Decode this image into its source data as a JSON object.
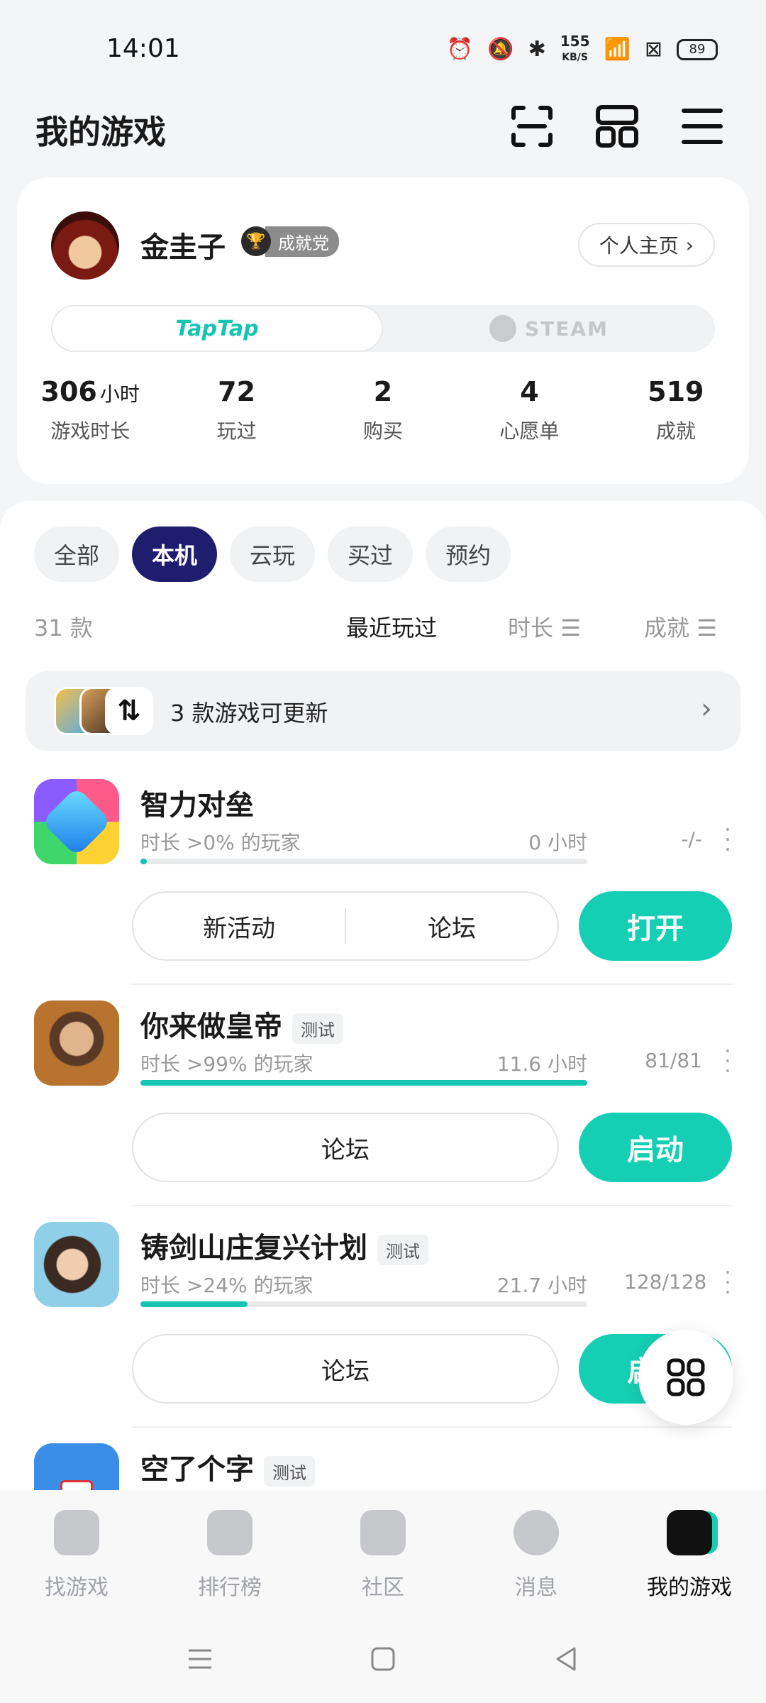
{
  "status_bar": {
    "time": "14:01",
    "net_speed": "155",
    "net_unit": "KB/S",
    "battery": "89"
  },
  "header": {
    "title": "我的游戏"
  },
  "profile": {
    "username": "金圭子",
    "badge": "成就党",
    "home_button": "个人主页",
    "platform_tabs": [
      "TapTap",
      "STEAM"
    ],
    "stats": [
      {
        "value": "306",
        "unit": "小时",
        "label": "游戏时长"
      },
      {
        "value": "72",
        "unit": "",
        "label": "玩过"
      },
      {
        "value": "2",
        "unit": "",
        "label": "购买"
      },
      {
        "value": "4",
        "unit": "",
        "label": "心愿单"
      },
      {
        "value": "519",
        "unit": "",
        "label": "成就"
      }
    ]
  },
  "filters": {
    "chips": [
      "全部",
      "本机",
      "云玩",
      "买过",
      "预约"
    ],
    "active": "本机"
  },
  "sort": {
    "count": "31 款",
    "recent": "最近玩过",
    "time": "时长",
    "achievements": "成就"
  },
  "update_banner": {
    "text": "3 款游戏可更新"
  },
  "games": [
    {
      "name": "智力对垒",
      "tag": "",
      "playtime_label": "时长 >0% 的玩家",
      "hours": "0 小时",
      "achievements": "-/-",
      "progress": 0.01,
      "actions": [
        "新活动",
        "论坛"
      ],
      "primary": "打开"
    },
    {
      "name": "你来做皇帝",
      "tag": "测试",
      "playtime_label": "时长 >99% 的玩家",
      "hours": "11.6 小时",
      "achievements": "81/81",
      "progress": 1.0,
      "actions": [
        "论坛"
      ],
      "primary": "启动"
    },
    {
      "name": "铸剑山庄复兴计划",
      "tag": "测试",
      "playtime_label": "时长 >24% 的玩家",
      "hours": "21.7 小时",
      "achievements": "128/128",
      "progress": 0.24,
      "actions": [
        "论坛"
      ],
      "primary": "启动"
    },
    {
      "name": "空了个字",
      "tag": "测试"
    }
  ],
  "bottom_nav": [
    "找游戏",
    "排行榜",
    "社区",
    "消息",
    "我的游戏"
  ],
  "colors": {
    "accent": "#15cfb4",
    "active_chip": "#1f1d6e"
  }
}
